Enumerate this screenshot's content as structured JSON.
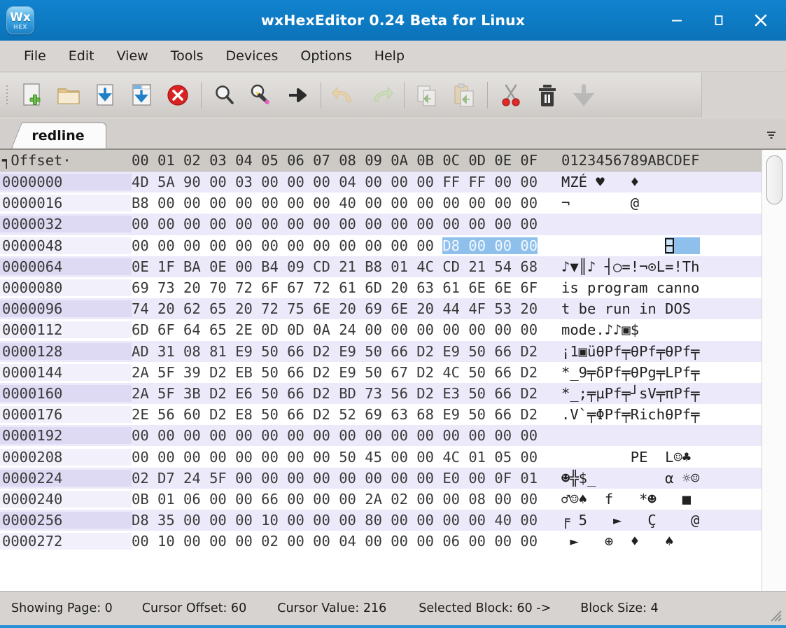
{
  "window": {
    "title": "wxHexEditor 0.24 Beta for Linux",
    "app_icon_top": "Wx",
    "app_icon_bottom": "HEX",
    "minimize_label": "–",
    "maximize_label": "☐",
    "close_label": "✕",
    "titlebar_color": "#0d7bc4"
  },
  "menubar": {
    "items": [
      {
        "label": "File"
      },
      {
        "label": "Edit"
      },
      {
        "label": "View"
      },
      {
        "label": "Tools"
      },
      {
        "label": "Devices"
      },
      {
        "label": "Options"
      },
      {
        "label": "Help"
      }
    ]
  },
  "toolbar": {
    "buttons": [
      {
        "name": "new-file-button",
        "icon": "new-file-icon",
        "enabled": true
      },
      {
        "name": "open-file-button",
        "icon": "open-folder-icon",
        "enabled": true
      },
      {
        "name": "save-file-button",
        "icon": "save-icon",
        "enabled": true
      },
      {
        "name": "save-as-button",
        "icon": "save-as-icon",
        "enabled": true
      },
      {
        "name": "close-file-button",
        "icon": "close-red-icon",
        "enabled": true
      },
      {
        "name": "find-button",
        "icon": "magnifier-icon",
        "enabled": true
      },
      {
        "name": "find-replace-button",
        "icon": "magnifier-pencil-icon",
        "enabled": true
      },
      {
        "name": "goto-button",
        "icon": "arrow-right-icon",
        "enabled": true
      },
      {
        "name": "undo-button",
        "icon": "undo-arrow-icon",
        "enabled": false
      },
      {
        "name": "redo-button",
        "icon": "redo-arrow-icon",
        "enabled": false
      },
      {
        "name": "copy-button",
        "icon": "copy-icon",
        "enabled": false
      },
      {
        "name": "paste-button",
        "icon": "paste-icon",
        "enabled": false
      },
      {
        "name": "cut-button",
        "icon": "scissors-icon",
        "enabled": true
      },
      {
        "name": "delete-button",
        "icon": "trash-icon",
        "enabled": true
      },
      {
        "name": "download-button",
        "icon": "down-arrow-icon",
        "enabled": false
      }
    ]
  },
  "tabs": {
    "active": "redline",
    "items": [
      {
        "label": "redline"
      }
    ],
    "overflow_icon": "chevron-down-icon"
  },
  "hexview": {
    "header": {
      "offset_label": "┑Offset·",
      "hex_columns": "00 01 02 03 04 05 06 07 08 09 0A 0B 0C 0D 0E 0F",
      "ascii_label": "0123456789ABCDEF"
    },
    "selection": {
      "row_index": 3,
      "hex_start_col": 12,
      "hex_len": 4,
      "ascii_start_col": 12,
      "ascii_len": 4
    },
    "rows": [
      {
        "offset": "0000000",
        "hex": "4D 5A 90 00 03 00 00 00 04 00 00 00 FF FF 00 00",
        "ascii": "MZÉ ♥   ♦"
      },
      {
        "offset": "0000016",
        "hex": "B8 00 00 00 00 00 00 00 40 00 00 00 00 00 00 00",
        "ascii": "¬       @"
      },
      {
        "offset": "0000032",
        "hex": "00 00 00 00 00 00 00 00 00 00 00 00 00 00 00 00",
        "ascii": ""
      },
      {
        "offset": "0000048",
        "hex": "00 00 00 00 00 00 00 00 00 00 00 00 D8 00 00 00",
        "ascii": ""
      },
      {
        "offset": "0000064",
        "hex": "0E 1F BA 0E 00 B4 09 CD 21 B8 01 4C CD 21 54 68",
        "ascii": "♪▼║♪ ┤○=!¬⊙L=!Th"
      },
      {
        "offset": "0000080",
        "hex": "69 73 20 70 72 6F 67 72 61 6D 20 63 61 6E 6E 6F",
        "ascii": "is program canno"
      },
      {
        "offset": "0000096",
        "hex": "74 20 62 65 20 72 75 6E 20 69 6E 20 44 4F 53 20",
        "ascii": "t be run in DOS "
      },
      {
        "offset": "0000112",
        "hex": "6D 6F 64 65 2E 0D 0D 0A 24 00 00 00 00 00 00 00",
        "ascii": "mode.♪♪▣$"
      },
      {
        "offset": "0000128",
        "hex": "AD 31 08 81 E9 50 66 D2 E9 50 66 D2 E9 50 66 D2",
        "ascii": "¡1▣üθPf╤θPf╤θPf╤"
      },
      {
        "offset": "0000144",
        "hex": "2A 5F 39 D2 EB 50 66 D2 E9 50 67 D2 4C 50 66 D2",
        "ascii": "*_9╤δPf╤θPg╤LPf╤"
      },
      {
        "offset": "0000160",
        "hex": "2A 5F 3B D2 E6 50 66 D2 BD 73 56 D2 E3 50 66 D2",
        "ascii": "*_;╤µPf╤┘sV╤πPf╤"
      },
      {
        "offset": "0000176",
        "hex": "2E 56 60 D2 E8 50 66 D2 52 69 63 68 E9 50 66 D2",
        "ascii": ".V`╤ΦPf╤RichθPf╤"
      },
      {
        "offset": "0000192",
        "hex": "00 00 00 00 00 00 00 00 00 00 00 00 00 00 00 00",
        "ascii": ""
      },
      {
        "offset": "0000208",
        "hex": "00 00 00 00 00 00 00 00 50 45 00 00 4C 01 05 00",
        "ascii": "        PE  L☺♣"
      },
      {
        "offset": "0000224",
        "hex": "02 D7 24 5F 00 00 00 00 00 00 00 00 E0 00 0F 01",
        "ascii": "☻╬$_        α ☼☺"
      },
      {
        "offset": "0000240",
        "hex": "0B 01 06 00 00 66 00 00 00 2A 02 00 00 08 00 00",
        "ascii": "♂☺♠  f   *☻   ■"
      },
      {
        "offset": "0000256",
        "hex": "D8 35 00 00 00 10 00 00 00 80 00 00 00 00 40 00",
        "ascii": "╒ 5   ►   Ç    @"
      },
      {
        "offset": "0000272",
        "hex": "00 10 00 00 00 02 00 00 04 00 00 00 06 00 00 00",
        "ascii": " ►   ⊕  ♦   ♠"
      }
    ]
  },
  "statusbar": {
    "showing_page": "Showing Page: 0",
    "cursor_offset": "Cursor Offset: 60",
    "cursor_value": "Cursor Value: 216",
    "selected_block": "Selected Block: 60 ->",
    "block_size": "Block Size: 4",
    "resize_grip_icon": "resize-grip-icon"
  }
}
